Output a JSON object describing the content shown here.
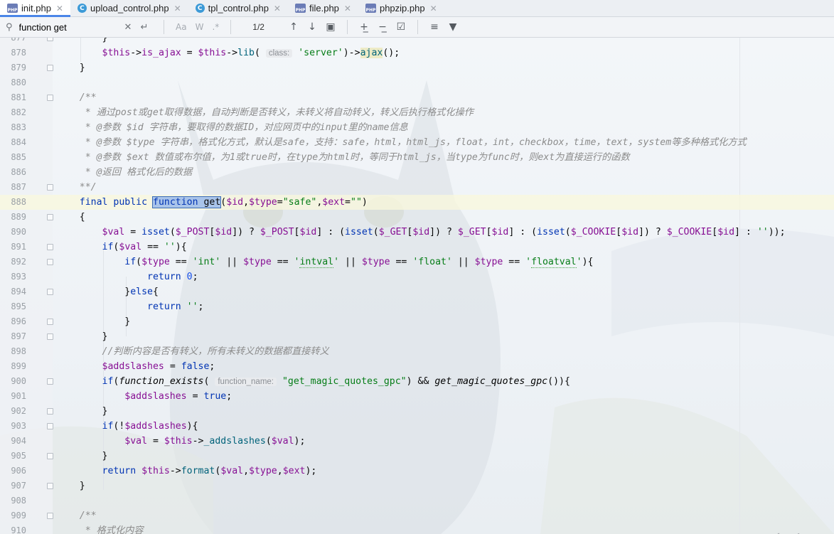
{
  "tabs": [
    {
      "label": "init.php",
      "icon": "php-file-icon",
      "active": true
    },
    {
      "label": "upload_control.php",
      "icon": "class-file-icon",
      "active": false
    },
    {
      "label": "tpl_control.php",
      "icon": "class-file-icon",
      "active": false
    },
    {
      "label": "file.php",
      "icon": "php-file-icon",
      "active": false
    },
    {
      "label": "phpzip.php",
      "icon": "php-file-icon",
      "active": false
    }
  ],
  "find": {
    "query": "function get",
    "match_case_label": "Aa",
    "words_label": "W",
    "regex_label": ".*",
    "match_count": "1/2"
  },
  "editor": {
    "line_numbers": [
      "877",
      "878",
      "879",
      "880",
      "881",
      "882",
      "883",
      "884",
      "885",
      "886",
      "887",
      "888",
      "889",
      "890",
      "891",
      "892",
      "893",
      "894",
      "895",
      "896",
      "897",
      "898",
      "899",
      "900",
      "901",
      "902",
      "903",
      "904",
      "905",
      "906",
      "907",
      "908",
      "909",
      "910"
    ],
    "current_line": "888",
    "hints": {
      "class": "class:",
      "function_name": "function_name:"
    }
  },
  "watermark": "PeiQi文库",
  "colors": {
    "keyword": "#0033b3",
    "variable": "#871094",
    "string": "#067d17",
    "comment": "#8c8c8c",
    "number": "#1750eb",
    "match_highlight": "#a9c4ea",
    "active_tab_underline": "#4a86e8"
  }
}
